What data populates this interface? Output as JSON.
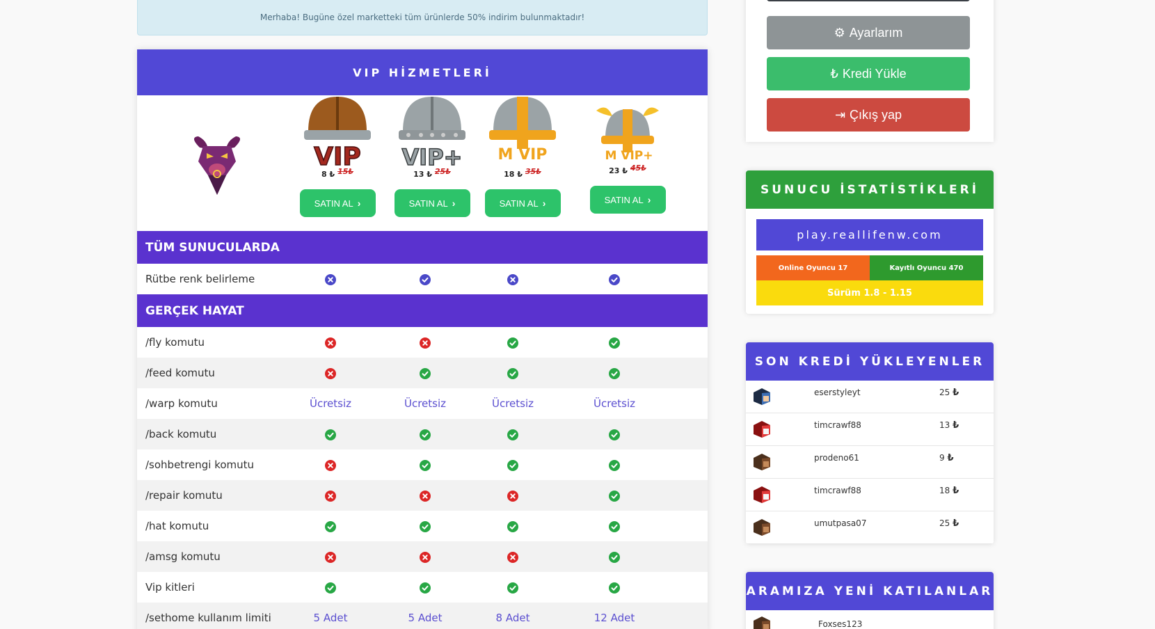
{
  "alert": {
    "text": "Merhaba! Bugüne özel marketteki tüm ürünlerde 50% indirim bulunmaktadır!"
  },
  "vip": {
    "title": "VIP HİZMETLERİ",
    "buy_label": "SATIN AL",
    "packages": [
      {
        "name": "VIP",
        "price": "8 ₺",
        "old_price": "15₺"
      },
      {
        "name": "VIP+",
        "price": "13 ₺",
        "old_price": "25₺"
      },
      {
        "name": "MVIP",
        "price": "18 ₺",
        "old_price": "35₺"
      },
      {
        "name": "MVIP+",
        "price": "23 ₺",
        "old_price": "45₺"
      }
    ],
    "sections": [
      {
        "title": "TÜM SUNUCULARDA",
        "rows": [
          {
            "name": "Rütbe renk belirleme",
            "values": [
              "cross-blue",
              "check-blue",
              "cross-blue",
              "check-blue"
            ]
          }
        ]
      },
      {
        "title": "GERÇEK HAYAT",
        "rows": [
          {
            "name": "/fly komutu",
            "values": [
              "cross",
              "cross",
              "check",
              "check"
            ]
          },
          {
            "name": "/feed komutu",
            "values": [
              "cross",
              "check",
              "check",
              "check"
            ]
          },
          {
            "name": "/warp komutu",
            "values": [
              "Ücretsiz",
              "Ücretsiz",
              "Ücretsiz",
              "Ücretsiz"
            ]
          },
          {
            "name": "/back komutu",
            "values": [
              "check",
              "check",
              "check",
              "check"
            ]
          },
          {
            "name": "/sohbetrengi komutu",
            "values": [
              "cross",
              "check",
              "check",
              "check"
            ]
          },
          {
            "name": "/repair komutu",
            "values": [
              "cross",
              "cross",
              "cross",
              "check"
            ]
          },
          {
            "name": "/hat komutu",
            "values": [
              "check",
              "check",
              "check",
              "check"
            ]
          },
          {
            "name": "/amsg komutu",
            "values": [
              "cross",
              "cross",
              "cross",
              "check"
            ]
          },
          {
            "name": "Vip kitleri",
            "values": [
              "check",
              "check",
              "check",
              "check"
            ]
          },
          {
            "name": "/sethome kullanım limiti",
            "values": [
              "5 Adet",
              "5 Adet",
              "8 Adet",
              "12 Adet"
            ]
          }
        ]
      }
    ]
  },
  "user_menu": {
    "settings": "Ayarlarım",
    "credit": "Kredi Yükle",
    "logout": "Çıkış yap"
  },
  "stats": {
    "title": "SUNUCU İSTATİSTİKLERİ",
    "server_ip": "play.reallifenw.com",
    "online": "Online Oyuncu 17",
    "registered": "Kayıtlı Oyuncu 470",
    "version": "Sürüm 1.8 - 1.15"
  },
  "credits": {
    "title": "SON KREDİ YÜKLEYENLER",
    "currency_icon": "₺",
    "rows": [
      {
        "user": "eserstyleyt",
        "amount": "25"
      },
      {
        "user": "timcrawf88",
        "amount": "13"
      },
      {
        "user": "prodeno61",
        "amount": "9"
      },
      {
        "user": "timcrawf88",
        "amount": "18"
      },
      {
        "user": "umutpasa07",
        "amount": "25"
      }
    ]
  },
  "joins": {
    "title": "ARAMIZA YENİ KATILANLAR",
    "rows": [
      {
        "user": "Foxses123"
      }
    ]
  },
  "colors": {
    "primary": "#5148d6",
    "section": "#5a32cf",
    "success": "#2dc36a",
    "danger": "#dc2626"
  }
}
